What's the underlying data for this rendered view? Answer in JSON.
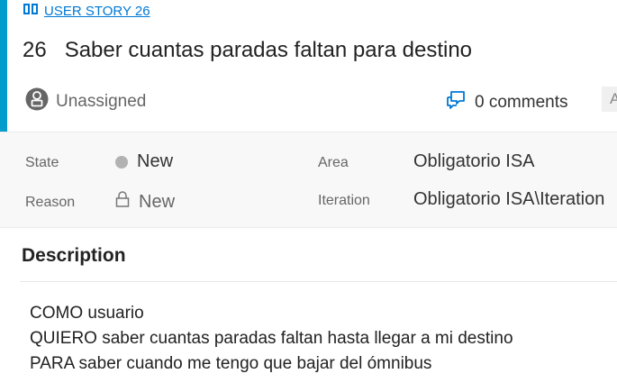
{
  "header": {
    "work_item_link": "USER STORY 26",
    "id": "26",
    "title": "Saber cuantas paradas faltan para destino",
    "assignee": "Unassigned",
    "comments": "0 comments",
    "right_chip": "A"
  },
  "fields": {
    "state_label": "State",
    "state_value": "New",
    "reason_label": "Reason",
    "reason_value": "New",
    "area_label": "Area",
    "area_value": "Obligatorio ISA",
    "iteration_label": "Iteration",
    "iteration_value": "Obligatorio ISA\\Iteration"
  },
  "description": {
    "title": "Description",
    "lines": [
      "COMO usuario",
      "QUIERO saber cuantas paradas faltan hasta llegar a mi destino",
      "PARA saber cuando me tengo que bajar del ómnibus"
    ]
  },
  "colors": {
    "accent": "#009ccc",
    "link": "#0078d4",
    "state_dot": "#b2b2b2"
  },
  "icons": {
    "work_item": "book-icon",
    "assignee": "person-icon",
    "comments": "comments-icon",
    "state": "status-dot",
    "reason": "lock-icon"
  }
}
